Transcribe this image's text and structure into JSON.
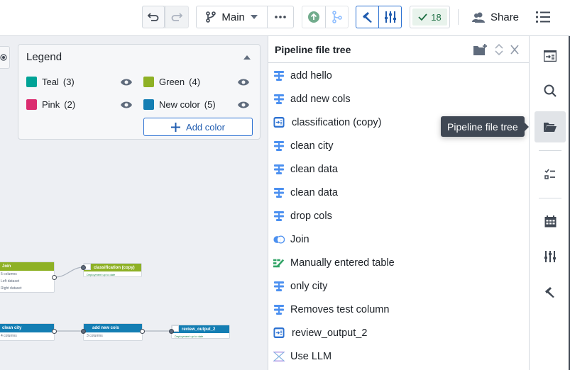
{
  "toolbar": {
    "branch_label": "Main",
    "check_count": "18",
    "share_label": "Share"
  },
  "legend": {
    "title": "Legend",
    "items": [
      {
        "name": "Teal",
        "count": "(3)",
        "color": "#00a396"
      },
      {
        "name": "Green",
        "count": "(4)",
        "color": "#8eb125"
      },
      {
        "name": "Pink",
        "count": "(2)",
        "color": "#db2c6f"
      },
      {
        "name": "New color",
        "count": "(5)",
        "color": "#147eb3"
      }
    ],
    "add_color_label": "Add color"
  },
  "graph": {
    "nodes": [
      {
        "title": "Join",
        "rows": [
          "5 columns",
          "Left dataset",
          "Right dataset"
        ],
        "color": "#8eb125"
      },
      {
        "title": "classification (copy)",
        "status": "Deployment up to date",
        "color": "#8eb125"
      },
      {
        "title": "clean city",
        "rows": [
          "4 columns"
        ],
        "color": "#147eb3"
      },
      {
        "title": "add new cols",
        "rows": [
          "3 columns"
        ],
        "color": "#147eb3"
      },
      {
        "title": "review_output_2",
        "status": "Deployment up to date",
        "color": "#147eb3"
      }
    ]
  },
  "panel": {
    "title": "Pipeline file tree",
    "items": [
      {
        "label": "add hello",
        "icon": "transform-icon"
      },
      {
        "label": "add new cols",
        "icon": "transform-icon"
      },
      {
        "label": "classification (copy)",
        "icon": "output-icon"
      },
      {
        "label": "clean city",
        "icon": "transform-icon"
      },
      {
        "label": "clean data",
        "icon": "transform-icon"
      },
      {
        "label": "clean data",
        "icon": "transform-icon"
      },
      {
        "label": "drop cols",
        "icon": "transform-icon"
      },
      {
        "label": "Join",
        "icon": "join-icon"
      },
      {
        "label": "Manually entered table",
        "icon": "manual-table-icon"
      },
      {
        "label": "only city",
        "icon": "transform-icon"
      },
      {
        "label": "Removes test column",
        "icon": "transform-icon"
      },
      {
        "label": "review_output_2",
        "icon": "output-icon"
      },
      {
        "label": "Use LLM",
        "icon": "llm-icon"
      }
    ]
  },
  "tooltip": {
    "text": "Pipeline file tree"
  }
}
